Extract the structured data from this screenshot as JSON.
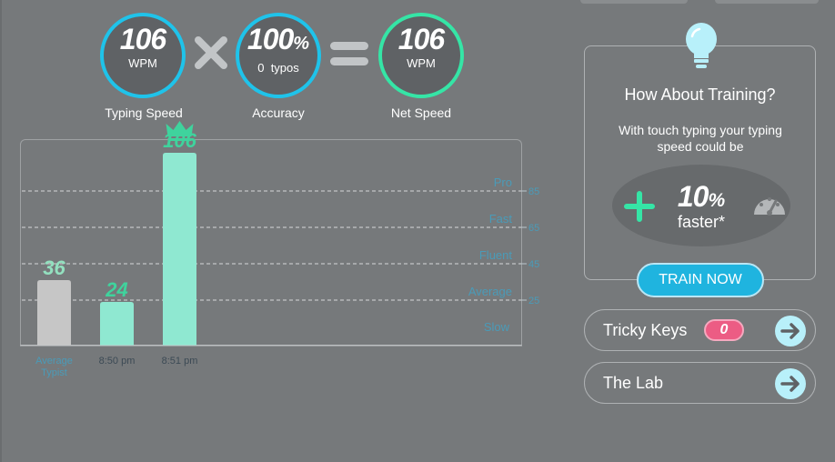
{
  "stats": {
    "typing_speed": {
      "value": "106",
      "unit": "WPM",
      "label": "Typing Speed"
    },
    "accuracy": {
      "value": "100",
      "unit_symbol": "%",
      "typos_count": "0",
      "typos_word": "typos",
      "label": "Accuracy"
    },
    "net_speed": {
      "value": "106",
      "unit": "WPM",
      "label": "Net Speed"
    }
  },
  "chart_data": {
    "type": "bar",
    "categories": [
      "Average Typist",
      "8:50 pm",
      "8:51 pm"
    ],
    "values": [
      36,
      24,
      106
    ],
    "data_labels": [
      "36",
      "24",
      "106"
    ],
    "colors": [
      "#c6c6c6",
      "#8fe8d1",
      "#8fe8d1"
    ],
    "label_colors": [
      "#93e0bf",
      "#3fd39d",
      "#3fd39d"
    ],
    "highlight_top": "crown-icon",
    "ylim": [
      0,
      115
    ],
    "reference_lines": [
      {
        "value": 85,
        "label": "Pro"
      },
      {
        "value": 65,
        "label": "Fast"
      },
      {
        "value": 45,
        "label": "Fluent"
      },
      {
        "value": 25,
        "label": "Average"
      }
    ],
    "bottom_band_label": "Slow",
    "title": "",
    "xlabel": "",
    "ylabel": ""
  },
  "training": {
    "title": "How About Training?",
    "subtitle": "With touch typing your typing speed could be",
    "percent": "10",
    "percent_symbol": "%",
    "faster_text": "faster*",
    "button_label": "TRAIN NOW"
  },
  "links": [
    {
      "label": "Tricky Keys",
      "badge": "0"
    },
    {
      "label": "The Lab"
    }
  ],
  "icons": {
    "operator_multiply": "multiply-icon",
    "operator_equals": "equals-icon",
    "bulb": "lightbulb-icon",
    "plus": "plus-icon",
    "gauge": "speedometer-icon",
    "arrow": "arrow-right-icon",
    "crown": "crown-icon"
  },
  "colors": {
    "accent_blue": "#1fc3ea",
    "accent_green": "#35e5a6",
    "badge_pink": "#ec5c84",
    "button_blue": "#1fb4df",
    "line_label_blue": "#4a9bb8"
  }
}
